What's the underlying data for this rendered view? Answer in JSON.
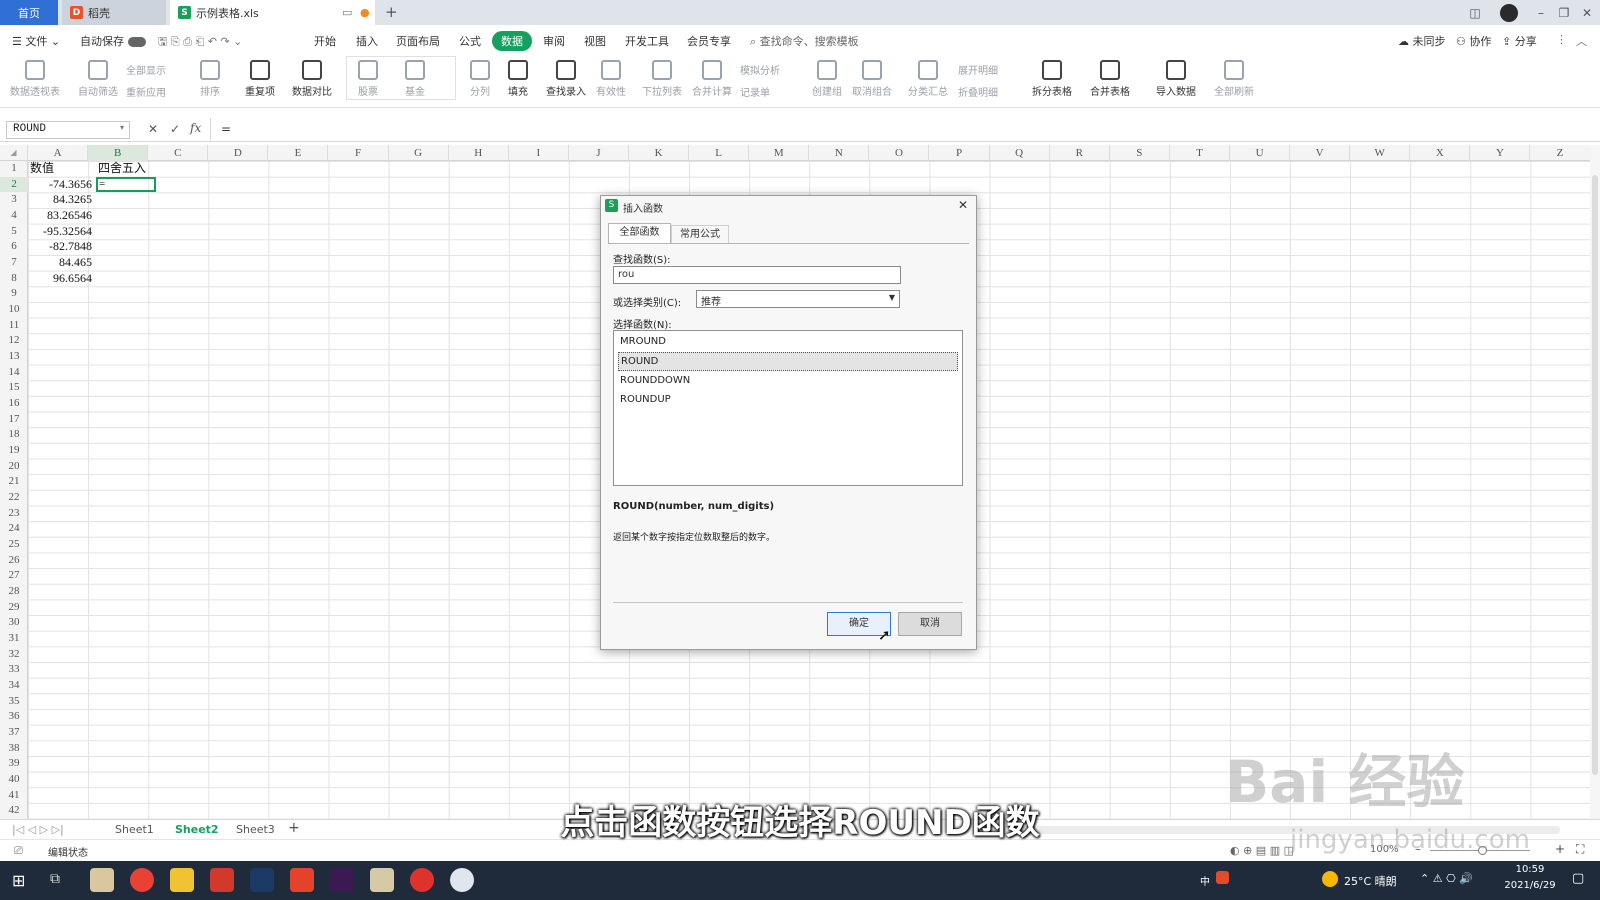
{
  "tabs": {
    "home": "首页",
    "docer": "稻壳",
    "file": "示例表格.xls"
  },
  "menu": {
    "file": "文件",
    "autosave": "自动保存",
    "items": [
      "开始",
      "插入",
      "页面布局",
      "公式",
      "数据",
      "审阅",
      "视图",
      "开发工具",
      "会员专享"
    ],
    "active": "数据",
    "search": "查找命令、搜索模板",
    "right": [
      "未同步",
      "协作",
      "分享"
    ]
  },
  "ribbon": {
    "buttons": [
      "数据透视表",
      "自动筛选",
      "排序",
      "重复项",
      "数据对比",
      "股票",
      "基金",
      "分列",
      "填充",
      "查找录入",
      "有效性",
      "下拉列表",
      "合并计算",
      "创建组",
      "取消组合",
      "分类汇总",
      "拆分表格",
      "合并表格",
      "导入数据",
      "全部刷新"
    ],
    "small": [
      "全部显示",
      "重新应用",
      "模拟分析",
      "记录单",
      "展开明细",
      "折叠明细"
    ]
  },
  "formula_bar": {
    "name_box": "ROUND",
    "formula": "="
  },
  "columns": [
    "A",
    "B",
    "C",
    "D",
    "E",
    "F",
    "G",
    "H",
    "I",
    "J",
    "K",
    "L",
    "M",
    "N",
    "O",
    "P",
    "Q",
    "R",
    "S",
    "T",
    "U",
    "V",
    "W",
    "X",
    "Y",
    "Z"
  ],
  "cells": {
    "A1": "数值",
    "B1": "四舍五入",
    "A2": "-74.3656",
    "B2": "=",
    "A3": "84.3265",
    "A4": "83.26546",
    "A5": "-95.32564",
    "A6": "-82.7848",
    "A7": "84.465",
    "A8": "96.6564"
  },
  "dialog": {
    "title": "插入函数",
    "tabs": [
      "全部函数",
      "常用公式"
    ],
    "search_label": "查找函数(S):",
    "search_value": "rou",
    "category_label": "或选择类别(C):",
    "category_value": "推荐",
    "list_label": "选择函数(N):",
    "functions": [
      "MROUND",
      "ROUND",
      "ROUNDDOWN",
      "ROUNDUP"
    ],
    "selected": "ROUND",
    "signature": "ROUND(number, num_digits)",
    "description": "返回某个数字按指定位数取整后的数字。",
    "ok": "确定",
    "cancel": "取消"
  },
  "sheets": [
    "Sheet1",
    "Sheet2",
    "Sheet3"
  ],
  "active_sheet": "Sheet2",
  "status": {
    "mode": "编辑状态",
    "zoom": "100%"
  },
  "taskbar": {
    "ime": "中",
    "weather": "25°C 晴朗",
    "time": "10:59",
    "date": "2021/6/29"
  },
  "caption": "点击函数按钮选择ROUND函数",
  "watermark": {
    "brand": "Bai 经验",
    "url": "jingyan.baidu.com"
  },
  "colors": {
    "accent_green": "#14a15f",
    "home_tab": "#2f6fd6",
    "taskbar": "#1f2b3a"
  }
}
